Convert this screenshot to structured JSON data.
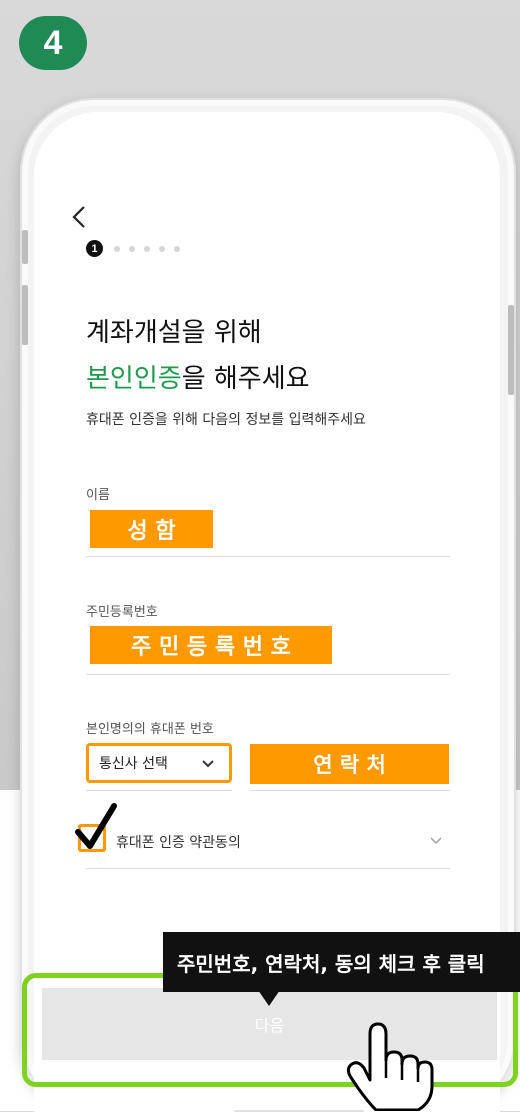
{
  "step": {
    "number": "4"
  },
  "screen": {
    "headline_line1": "계좌개설을 위해",
    "headline_accent": "본인인증",
    "headline_line2_rest": "을 해주세요",
    "subtitle": "휴대폰 인증을 위해 다음의 정보를 입력해주세요",
    "progress": {
      "current": "1",
      "total_dots": 6
    },
    "name_field": {
      "label": "이름",
      "annotation": "성 함"
    },
    "rrn_field": {
      "label": "주민등록번호",
      "annotation": "주 민 등 록 번 호"
    },
    "phone_field": {
      "label": "본인명의의 휴대폰 번호",
      "carrier_placeholder": "통신사 선택",
      "annotation": "연 락 처"
    },
    "agreement": {
      "label": "휴대폰 인증 약관동의",
      "checked": true
    },
    "next_button": {
      "label": "다음"
    }
  },
  "tooltip": {
    "text": "주민번호, 연락처, 동의 체크 후 클릭"
  },
  "colors": {
    "accent_green": "#1f9a4a",
    "badge_green": "#1f8a54",
    "annotation_orange": "#ff9900",
    "highlight_green": "#7ed321"
  }
}
